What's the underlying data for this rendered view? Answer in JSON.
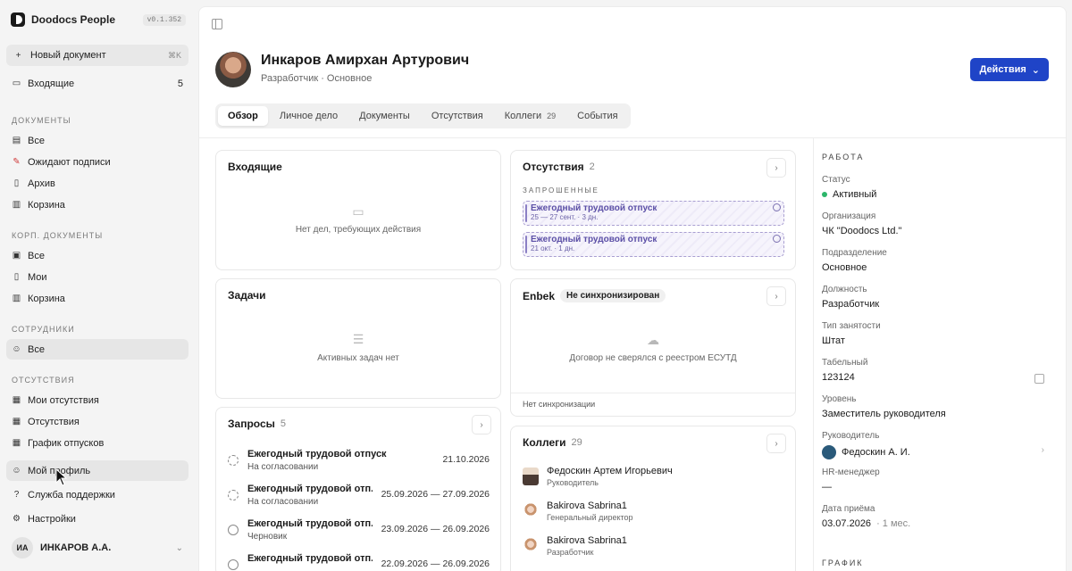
{
  "app": {
    "name": "Doodocs People",
    "version": "v0.1.352"
  },
  "sidebar": {
    "new_doc": {
      "label": "Новый документ",
      "shortcut": "⌘K"
    },
    "inbox": {
      "label": "Входящие",
      "count": "5"
    },
    "sections": {
      "documents": "ДОКУМЕНТЫ",
      "corp_documents": "КОРП. ДОКУМЕНТЫ",
      "employees": "СОТРУДНИКИ",
      "absences": "ОТСУТСТВИЯ"
    },
    "documents": [
      "Все",
      "Ожидают подписи",
      "Архив",
      "Корзина"
    ],
    "corp_documents": [
      "Все",
      "Мои",
      "Корзина"
    ],
    "employees": [
      "Все"
    ],
    "absences": [
      "Мои отсутствия",
      "Отсутствия",
      "График отпусков"
    ],
    "bottom": [
      "Мой профиль",
      "Служба поддержки",
      "Настройки"
    ],
    "user": {
      "initials": "ИА",
      "name": "ИНКАРОВ А.А."
    }
  },
  "profile": {
    "name": "Инкаров Амирхан Артурович",
    "subtitle": "Разработчик · Основное",
    "actions_label": "Действия"
  },
  "tabs": [
    {
      "label": "Обзор",
      "count": ""
    },
    {
      "label": "Личное дело",
      "count": ""
    },
    {
      "label": "Документы",
      "count": ""
    },
    {
      "label": "Отсутствия",
      "count": ""
    },
    {
      "label": "Коллеги",
      "count": "29"
    },
    {
      "label": "События",
      "count": ""
    }
  ],
  "inbox_card": {
    "title": "Входящие",
    "empty_text": "Нет дел, требующих действия"
  },
  "tasks_card": {
    "title": "Задачи",
    "empty_text": "Активных задач нет"
  },
  "requests_card": {
    "title": "Запросы",
    "count": "5",
    "items": [
      {
        "title": "Ежегодный трудовой отпуск",
        "status": "На согласовании",
        "date": "21.10.2026"
      },
      {
        "title": "Ежегодный трудовой отп...",
        "status": "На согласовании",
        "date": "25.09.2026 — 27.09.2026"
      },
      {
        "title": "Ежегодный трудовой отп...",
        "status": "Черновик",
        "date": "23.09.2026 — 26.09.2026"
      },
      {
        "title": "Ежегодный трудовой отп...",
        "status": "",
        "date": "22.09.2026 — 26.09.2026"
      }
    ]
  },
  "absences_card": {
    "title": "Отсутствия",
    "count": "2",
    "requested_label": "ЗАПРОШЕННЫЕ",
    "items": [
      {
        "title": "Ежегодный трудовой отпуск",
        "meta": "25 — 27 сент. · 3 дн."
      },
      {
        "title": "Ежегодный трудовой отпуск",
        "meta": "21 окт. · 1 дн."
      }
    ]
  },
  "enbek_card": {
    "title": "Enbek",
    "badge": "Не синхронизирован",
    "empty_text": "Договор не сверялся с реестром ЕСУТД",
    "footer": "Нет синхронизации"
  },
  "colleagues_card": {
    "title": "Коллеги",
    "count": "29",
    "items": [
      {
        "name": "Федоскин Артем Игорьевич",
        "role": "Руководитель"
      },
      {
        "name": "Bakirova Sabrina1",
        "role": "Генеральный директор"
      },
      {
        "name": "Bakirova Sabrina1",
        "role": "Разработчик"
      }
    ]
  },
  "details": {
    "heading": "РАБОТА",
    "rows": [
      {
        "label": "Статус",
        "value": "Активный"
      },
      {
        "label": "Организация",
        "value": "ЧК \"Doodocs Ltd.\""
      },
      {
        "label": "Подразделение",
        "value": "Основное"
      },
      {
        "label": "Должность",
        "value": "Разработчик"
      },
      {
        "label": "Тип занятости",
        "value": "Штат"
      },
      {
        "label": "Табельный",
        "value": "123124"
      },
      {
        "label": "Уровень",
        "value": "Заместитель руководителя"
      },
      {
        "label": "Руководитель",
        "value": "Федоскин А. И."
      },
      {
        "label": "HR-менеджер",
        "value": "—"
      },
      {
        "label": "Дата приёма",
        "value": "03.07.2026",
        "extra": "· 1 мес."
      }
    ],
    "next_heading": "ГРАФИК"
  },
  "colors": {
    "accent": "#1f44c7",
    "status_active": "#2cb66a",
    "absence_purple": "#5b4fa6"
  }
}
